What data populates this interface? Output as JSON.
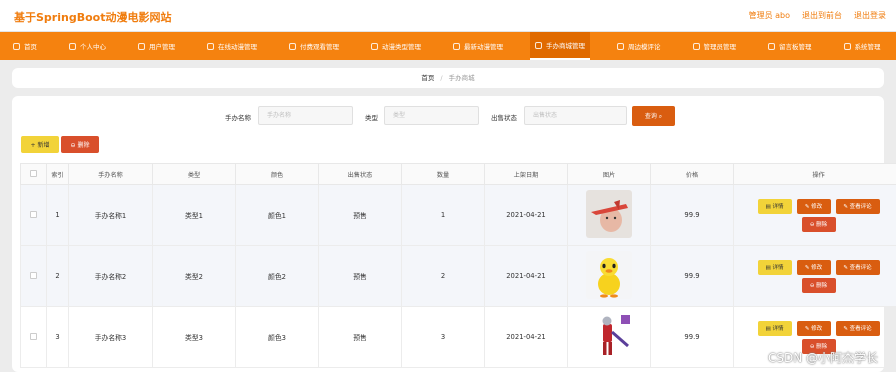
{
  "header": {
    "site_title": "基于SpringBoot动漫电影网站",
    "admin_label": "管理员 abo",
    "back_label": "退出到前台",
    "logout_label": "退出登录"
  },
  "nav": {
    "items": [
      {
        "label": "首页"
      },
      {
        "label": "个人中心"
      },
      {
        "label": "用户管理"
      },
      {
        "label": "在线动漫管理"
      },
      {
        "label": "付费观看管理"
      },
      {
        "label": "动漫类型管理"
      },
      {
        "label": "最新动漫管理"
      },
      {
        "label": "手办商城管理"
      },
      {
        "label": "周边模评论"
      },
      {
        "label": "管理员管理"
      },
      {
        "label": "留言板管理"
      },
      {
        "label": "系统管理"
      }
    ]
  },
  "breadcrumb": {
    "home": "首页",
    "sep": "/",
    "current": "手办商城"
  },
  "search": {
    "name_label": "手办名称",
    "name_placeholder": "手办名称",
    "type_label": "类型",
    "type_placeholder": "类型",
    "status_label": "出售状态",
    "status_placeholder": "出售状态",
    "button_label": "查询 ⌕"
  },
  "actions": {
    "add_label": "+ 新增",
    "delete_label": "⊖ 删除"
  },
  "table": {
    "headers": [
      "索引",
      "手办名称",
      "类型",
      "颜色",
      "出售状态",
      "数量",
      "上架日期",
      "图片",
      "价格",
      "操作"
    ],
    "rows": [
      {
        "index": "1",
        "name": "手办名称1",
        "type": "类型1",
        "color": "颜色1",
        "status": "预售",
        "quantity": "1",
        "date": "2021-04-21",
        "image": "plane-figure",
        "price": "99.9"
      },
      {
        "index": "2",
        "name": "手办名称2",
        "type": "类型2",
        "color": "颜色2",
        "status": "预售",
        "quantity": "2",
        "date": "2021-04-21",
        "image": "duck-figure",
        "price": "99.9"
      },
      {
        "index": "3",
        "name": "手办名称3",
        "type": "类型3",
        "color": "颜色3",
        "status": "预售",
        "quantity": "3",
        "date": "2021-04-21",
        "image": "hero-figure",
        "price": "99.9"
      }
    ],
    "op_labels": {
      "detail": "▤ 详情",
      "edit": "✎ 修改",
      "review": "✎ 查看评论",
      "delete": "⊖ 删除"
    }
  },
  "watermark": "CSDN @小阿杰学长",
  "colors": {
    "primary": "#f5820f",
    "title": "#f07c0d",
    "danger": "#d94f2b",
    "warning": "#f2d339"
  }
}
